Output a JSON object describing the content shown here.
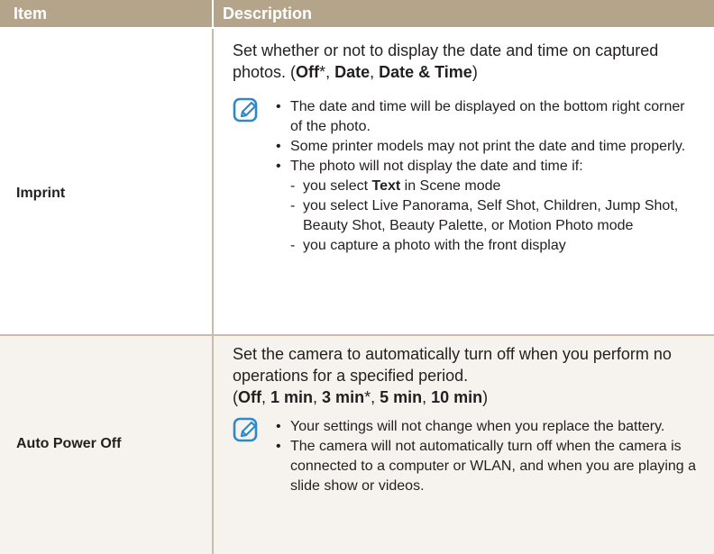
{
  "header": {
    "item": "Item",
    "description": "Description"
  },
  "rows": [
    {
      "item": "Imprint",
      "desc_intro": "Set whether or not to display the date and time on captured photos. (",
      "options": [
        "Off",
        "Date",
        "Date & Time"
      ],
      "default_mark": "*",
      "note_icon": "note-pencil-icon",
      "notes": [
        "The date and time will be displayed on the bottom right corner of the photo.",
        "Some printer models may not print the date and time properly.",
        "The photo will not display the date and time if:"
      ],
      "subnotes": [
        {
          "pre": "you select ",
          "bold": "Text",
          "post": " in Scene mode"
        },
        {
          "text": "you select Live Panorama, Self Shot, Children, Jump Shot, Beauty Shot, Beauty Palette, or Motion Photo mode"
        },
        {
          "text": "you capture a photo with the front display"
        }
      ]
    },
    {
      "item": "Auto Power Off",
      "desc_intro": "Set the camera to automatically turn off when you perform no operations for a specified period.",
      "options": [
        "Off",
        "1 min",
        "3 min",
        "5 min",
        "10 min"
      ],
      "default_mark": "*",
      "note_icon": "note-pencil-icon",
      "notes": [
        "Your settings will not change when you replace the battery.",
        "The camera will not automatically turn off when the camera is connected to a computer or WLAN, and when you are playing a slide show or videos."
      ]
    }
  ],
  "colors": {
    "header_bg": "#b3a48a",
    "row_alt_bg": "#f6f3ee",
    "icon": "#2f89c8"
  }
}
